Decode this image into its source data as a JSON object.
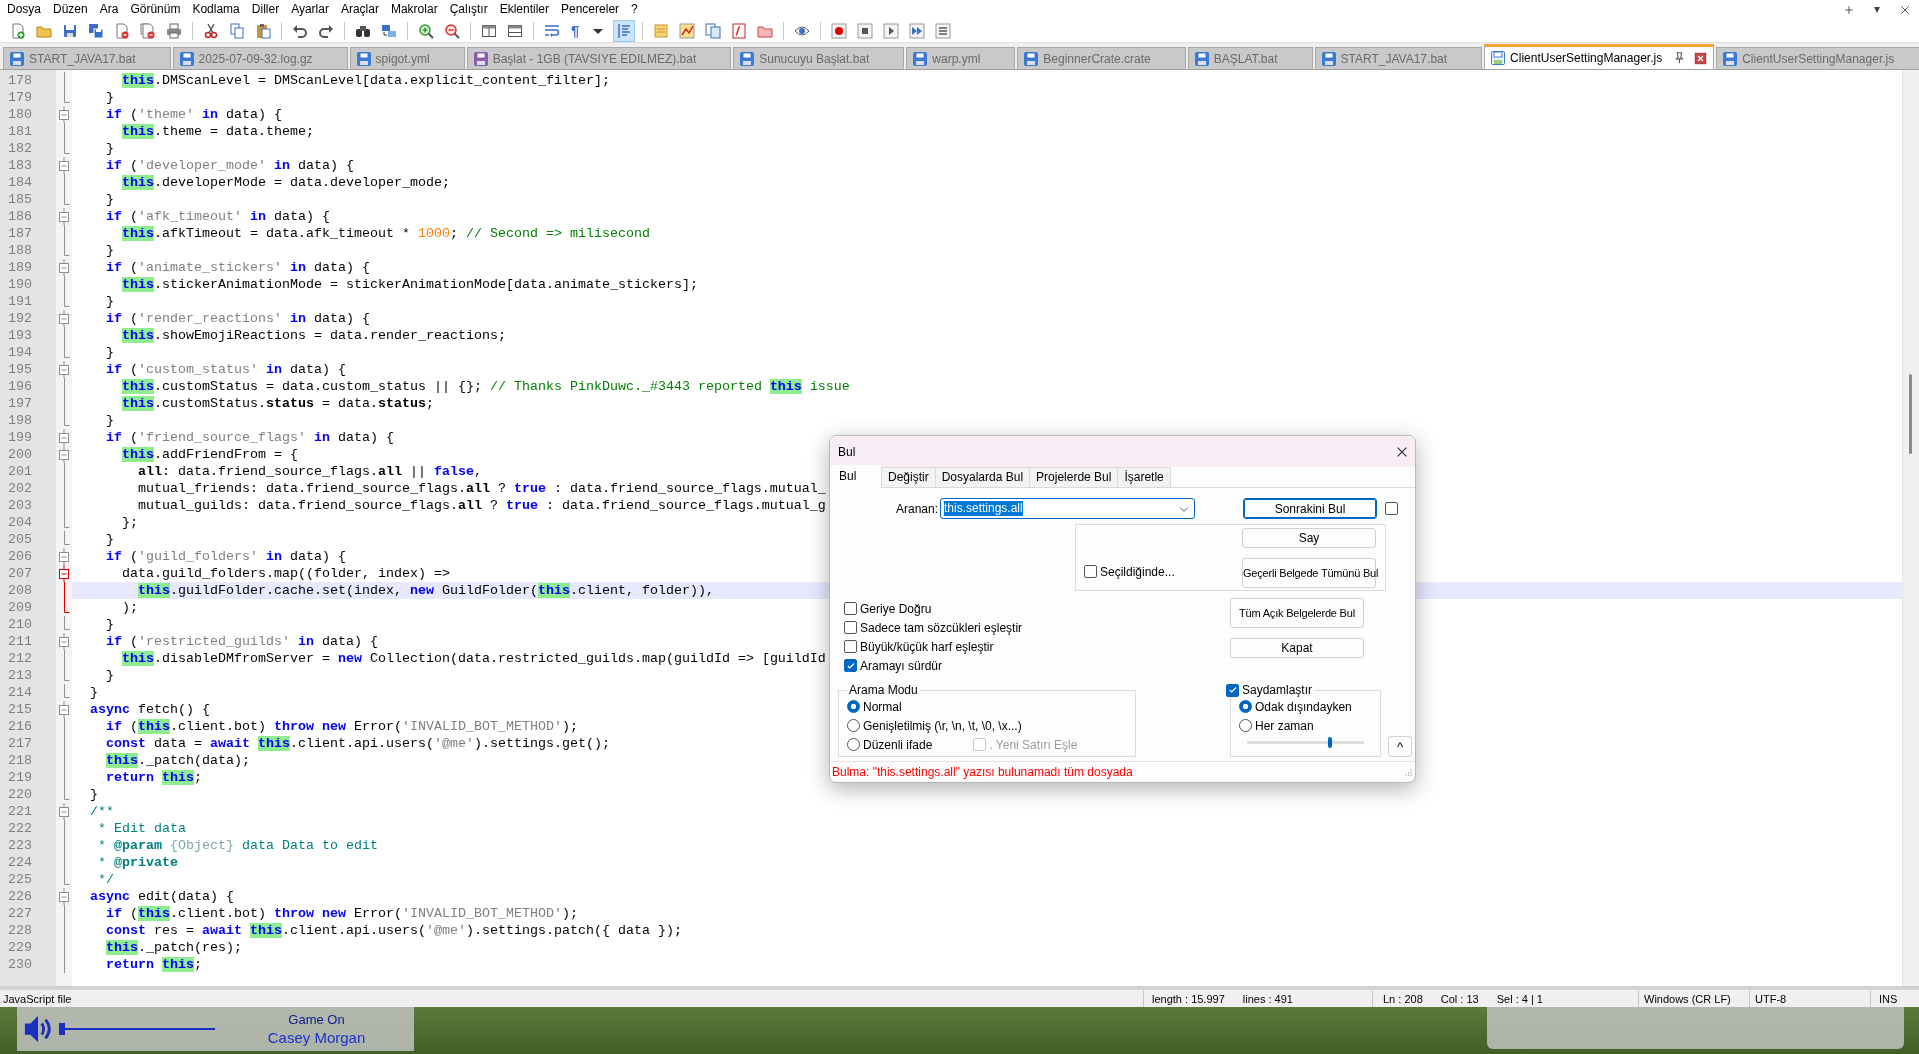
{
  "menu": [
    "Dosya",
    "Düzen",
    "Ara",
    "Görünüm",
    "Kodlama",
    "Diller",
    "Ayarlar",
    "Araçlar",
    "Makrolar",
    "Çalıştır",
    "Eklentiler",
    "Pencereler",
    "?"
  ],
  "toolbar": [
    {
      "kind": "new",
      "pressed": false
    },
    {
      "kind": "open",
      "pressed": false
    },
    {
      "kind": "save",
      "pressed": false
    },
    {
      "kind": "saveall",
      "pressed": false
    },
    {
      "kind": "close",
      "pressed": false
    },
    {
      "kind": "closeall",
      "pressed": false
    },
    {
      "kind": "print",
      "pressed": false
    },
    {
      "kind": "sep"
    },
    {
      "kind": "cut",
      "pressed": false
    },
    {
      "kind": "copy",
      "pressed": false
    },
    {
      "kind": "paste",
      "pressed": false
    },
    {
      "kind": "sep"
    },
    {
      "kind": "undo",
      "pressed": false
    },
    {
      "kind": "redo",
      "pressed": false
    },
    {
      "kind": "sep"
    },
    {
      "kind": "find",
      "pressed": false
    },
    {
      "kind": "replace",
      "pressed": false
    },
    {
      "kind": "sep"
    },
    {
      "kind": "zoomin",
      "pressed": false
    },
    {
      "kind": "zoomout",
      "pressed": false
    },
    {
      "kind": "sep"
    },
    {
      "kind": "syncv",
      "pressed": false
    },
    {
      "kind": "synch",
      "pressed": false
    },
    {
      "kind": "sep"
    },
    {
      "kind": "wrap",
      "pressed": false
    },
    {
      "kind": "glyph",
      "text": "¶",
      "pressed": false
    },
    {
      "kind": "caret",
      "pressed": false
    },
    {
      "kind": "indentguide",
      "pressed": true
    },
    {
      "kind": "sep"
    },
    {
      "kind": "udl",
      "pressed": false
    },
    {
      "kind": "docmap",
      "pressed": false
    },
    {
      "kind": "doclist",
      "pressed": false
    },
    {
      "kind": "funclist",
      "pressed": false
    },
    {
      "kind": "folderws",
      "pressed": false
    },
    {
      "kind": "sep"
    },
    {
      "kind": "monitor",
      "pressed": false
    },
    {
      "kind": "sep"
    },
    {
      "kind": "record",
      "pressed": false
    },
    {
      "kind": "stop",
      "pressed": false
    },
    {
      "kind": "play",
      "pressed": false
    },
    {
      "kind": "playmulti",
      "pressed": false
    },
    {
      "kind": "savemacro",
      "pressed": false
    }
  ],
  "tabs": [
    {
      "label": "START_JAVA17.bat",
      "kind": "saved",
      "selected": false
    },
    {
      "label": "2025-07-09-32.log.gz",
      "kind": "saved",
      "selected": false
    },
    {
      "label": "spigot.yml",
      "kind": "saved",
      "selected": false
    },
    {
      "label": "Başlat - 1GB (TAVSIYE EDILMEZ).bat",
      "kind": "readonly",
      "selected": false
    },
    {
      "label": "Sunucuyu Başlat.bat",
      "kind": "saved",
      "selected": false
    },
    {
      "label": "warp.yml",
      "kind": "saved",
      "selected": false
    },
    {
      "label": "BeginnerCrate.crate",
      "kind": "saved",
      "selected": false
    },
    {
      "label": "BAŞLAT.bat",
      "kind": "saved",
      "selected": false
    },
    {
      "label": "START_JAVA17.bat",
      "kind": "saved",
      "selected": false
    },
    {
      "label": "ClientUserSettingManager.js",
      "kind": "saved",
      "selected": true
    },
    {
      "label": "ClientUserSettingManager.js",
      "kind": "saved",
      "selected": false
    }
  ],
  "editor": {
    "lines": [
      {
        "number": "178",
        "kind": "mid",
        "active": false,
        "current": false,
        "tokens": [
          {
            "kind": "hl",
            "text": "      this"
          },
          ".DMScanLevel = DMScanLevel[data.explicit_content_filter];"
        ]
      },
      {
        "number": "179",
        "kind": "end",
        "active": false,
        "current": false,
        "tokens": [
          "    }"
        ]
      },
      {
        "number": "180",
        "kind": "open",
        "active": false,
        "current": false,
        "tokens": [
          {
            "kind": "kw",
            "text": "    if"
          },
          " (",
          {
            "kind": "str",
            "text": "'theme'"
          },
          {
            "kind": "kw",
            "text": " in"
          },
          " data) {"
        ]
      },
      {
        "number": "181",
        "kind": "mid",
        "active": false,
        "current": false,
        "tokens": [
          {
            "kind": "hl",
            "text": "      this"
          },
          ".theme = data.theme;"
        ]
      },
      {
        "number": "182",
        "kind": "end",
        "active": false,
        "current": false,
        "tokens": [
          "    }"
        ]
      },
      {
        "number": "183",
        "kind": "open",
        "active": false,
        "current": false,
        "tokens": [
          {
            "kind": "kw",
            "text": "    if"
          },
          " (",
          {
            "kind": "str",
            "text": "'developer_mode'"
          },
          {
            "kind": "kw",
            "text": " in"
          },
          " data) {"
        ]
      },
      {
        "number": "184",
        "kind": "mid",
        "active": false,
        "current": false,
        "tokens": [
          {
            "kind": "hl",
            "text": "      this"
          },
          ".developerMode = data.developer_mode;"
        ]
      },
      {
        "number": "185",
        "kind": "end",
        "active": false,
        "current": false,
        "tokens": [
          "    }"
        ]
      },
      {
        "number": "186",
        "kind": "open",
        "active": false,
        "current": false,
        "tokens": [
          {
            "kind": "kw",
            "text": "    if"
          },
          " (",
          {
            "kind": "str",
            "text": "'afk_timeout'"
          },
          {
            "kind": "kw",
            "text": " in"
          },
          " data) {"
        ]
      },
      {
        "number": "187",
        "kind": "mid",
        "active": false,
        "current": false,
        "tokens": [
          {
            "kind": "hl",
            "text": "      this"
          },
          ".afkTimeout = data.afk_timeout * ",
          {
            "kind": "num",
            "text": "1000"
          },
          ";",
          {
            "kind": "cm",
            "text": " // Second => milisecond"
          }
        ]
      },
      {
        "number": "188",
        "kind": "end",
        "active": false,
        "current": false,
        "tokens": [
          "    }"
        ]
      },
      {
        "number": "189",
        "kind": "open",
        "active": false,
        "current": false,
        "tokens": [
          {
            "kind": "kw",
            "text": "    if"
          },
          " (",
          {
            "kind": "str",
            "text": "'animate_stickers'"
          },
          {
            "kind": "kw",
            "text": " in"
          },
          " data) {"
        ]
      },
      {
        "number": "190",
        "kind": "mid",
        "active": false,
        "current": false,
        "tokens": [
          {
            "kind": "hl",
            "text": "      this"
          },
          ".stickerAnimationMode = stickerAnimationMode[data.animate_stickers];"
        ]
      },
      {
        "number": "191",
        "kind": "end",
        "active": false,
        "current": false,
        "tokens": [
          "    }"
        ]
      },
      {
        "number": "192",
        "kind": "open",
        "active": false,
        "current": false,
        "tokens": [
          {
            "kind": "kw",
            "text": "    if"
          },
          " (",
          {
            "kind": "str",
            "text": "'render_reactions'"
          },
          {
            "kind": "kw",
            "text": " in"
          },
          " data) {"
        ]
      },
      {
        "number": "193",
        "kind": "mid",
        "active": false,
        "current": false,
        "tokens": [
          {
            "kind": "hl",
            "text": "      this"
          },
          ".showEmojiReactions = data.render_reactions;"
        ]
      },
      {
        "number": "194",
        "kind": "end",
        "active": false,
        "current": false,
        "tokens": [
          "    }"
        ]
      },
      {
        "number": "195",
        "kind": "open",
        "active": false,
        "current": false,
        "tokens": [
          {
            "kind": "kw",
            "text": "    if"
          },
          " (",
          {
            "kind": "str",
            "text": "'custom_status'"
          },
          {
            "kind": "kw",
            "text": " in"
          },
          " data) {"
        ]
      },
      {
        "number": "196",
        "kind": "mid",
        "active": false,
        "current": false,
        "tokens": [
          {
            "kind": "hl",
            "text": "      this"
          },
          ".customStatus = data.custom_status || {};",
          {
            "kind": "cm",
            "text": " // Thanks PinkDuwc._#3443 reported "
          },
          {
            "kind": "hl",
            "text": "this"
          },
          {
            "kind": "cm",
            "text": " issue"
          }
        ]
      },
      {
        "number": "197",
        "kind": "mid",
        "active": false,
        "current": false,
        "tokens": [
          {
            "kind": "hl",
            "text": "      this"
          },
          ".customStatus.",
          {
            "kind": "b",
            "text": "status"
          },
          " = data.",
          {
            "kind": "b",
            "text": "status"
          },
          ";"
        ]
      },
      {
        "number": "198",
        "kind": "end",
        "active": false,
        "current": false,
        "tokens": [
          "    }"
        ]
      },
      {
        "number": "199",
        "kind": "open",
        "active": false,
        "current": false,
        "tokens": [
          {
            "kind": "kw",
            "text": "    if"
          },
          " (",
          {
            "kind": "str",
            "text": "'friend_source_flags'"
          },
          {
            "kind": "kw",
            "text": " in"
          },
          " data) {"
        ]
      },
      {
        "number": "200",
        "kind": "open",
        "active": false,
        "current": false,
        "tokens": [
          {
            "kind": "hl",
            "text": "      this"
          },
          ".addFriendFrom = {"
        ]
      },
      {
        "number": "201",
        "kind": "mid",
        "active": false,
        "current": false,
        "tokens": [
          {
            "kind": "b",
            "text": "        all"
          },
          ": data.friend_source_flags.",
          {
            "kind": "b",
            "text": "all"
          },
          " || ",
          {
            "kind": "kw",
            "text": "false"
          },
          ","
        ]
      },
      {
        "number": "202",
        "kind": "mid",
        "active": false,
        "current": false,
        "tokens": [
          "        mutual_friends: data.friend_source_flags.",
          {
            "kind": "b",
            "text": "all"
          },
          " ? ",
          {
            "kind": "kw",
            "text": "true"
          },
          " : data.friend_source_flags.mutual_"
        ]
      },
      {
        "number": "203",
        "kind": "mid",
        "active": false,
        "current": false,
        "tokens": [
          "        mutual_guilds: data.friend_source_flags.",
          {
            "kind": "b",
            "text": "all"
          },
          " ? ",
          {
            "kind": "kw",
            "text": "true"
          },
          " : data.friend_source_flags.mutual_g"
        ]
      },
      {
        "number": "204",
        "kind": "end",
        "active": false,
        "current": false,
        "tokens": [
          "      };"
        ]
      },
      {
        "number": "205",
        "kind": "end",
        "active": false,
        "current": false,
        "tokens": [
          "    }"
        ]
      },
      {
        "number": "206",
        "kind": "open",
        "active": false,
        "current": false,
        "tokens": [
          {
            "kind": "kw",
            "text": "    if"
          },
          " (",
          {
            "kind": "str",
            "text": "'guild_folders'"
          },
          {
            "kind": "kw",
            "text": " in"
          },
          " data) {"
        ]
      },
      {
        "number": "207",
        "kind": "open",
        "active": true,
        "current": false,
        "tokens": [
          "      data.guild_folders.map((folder, index) =>"
        ]
      },
      {
        "number": "208",
        "kind": "mid",
        "active": true,
        "current": true,
        "tokens": [
          {
            "kind": "hl",
            "text": "        this"
          },
          ".guildFolder.cache.set(index,",
          {
            "kind": "kw",
            "text": " new"
          },
          " GuildFolder(",
          {
            "kind": "hl",
            "text": "this"
          },
          ".client, folder)),"
        ]
      },
      {
        "number": "209",
        "kind": "end",
        "active": true,
        "current": false,
        "tokens": [
          "      );"
        ]
      },
      {
        "number": "210",
        "kind": "end",
        "active": false,
        "current": false,
        "tokens": [
          "    }"
        ]
      },
      {
        "number": "211",
        "kind": "open",
        "active": false,
        "current": false,
        "tokens": [
          {
            "kind": "kw",
            "text": "    if"
          },
          " (",
          {
            "kind": "str",
            "text": "'restricted_guilds'"
          },
          {
            "kind": "kw",
            "text": " in"
          },
          " data) {"
        ]
      },
      {
        "number": "212",
        "kind": "mid",
        "active": false,
        "current": false,
        "tokens": [
          {
            "kind": "hl",
            "text": "      this"
          },
          ".disableDMfromServer =",
          {
            "kind": "kw",
            "text": " new"
          },
          " Collection(data.restricted_guilds.map(guildId => [guildId"
        ]
      },
      {
        "number": "213",
        "kind": "end",
        "active": false,
        "current": false,
        "tokens": [
          "    }"
        ]
      },
      {
        "number": "214",
        "kind": "end",
        "active": false,
        "current": false,
        "tokens": [
          "  }"
        ]
      },
      {
        "number": "215",
        "kind": "open",
        "active": false,
        "current": false,
        "tokens": [
          {
            "kind": "kw",
            "text": "  async"
          },
          " fetch() {"
        ]
      },
      {
        "number": "216",
        "kind": "mid",
        "active": false,
        "current": false,
        "tokens": [
          {
            "kind": "kw",
            "text": "    if"
          },
          " (",
          {
            "kind": "hl",
            "text": "this"
          },
          ".client.bot)",
          {
            "kind": "kw",
            "text": " throw new"
          },
          " Error(",
          {
            "kind": "str",
            "text": "'INVALID_BOT_METHOD'"
          },
          ");"
        ]
      },
      {
        "number": "217",
        "kind": "mid",
        "active": false,
        "current": false,
        "tokens": [
          {
            "kind": "kw",
            "text": "    const"
          },
          " data =",
          {
            "kind": "kw",
            "text": " await"
          },
          {
            "kind": "hl",
            "text": " this"
          },
          ".client.api.users(",
          {
            "kind": "str",
            "text": "'@me'"
          },
          ").settings.get();"
        ]
      },
      {
        "number": "218",
        "kind": "mid",
        "active": false,
        "current": false,
        "tokens": [
          {
            "kind": "hl",
            "text": "    this"
          },
          "._patch(data);"
        ]
      },
      {
        "number": "219",
        "kind": "mid",
        "active": false,
        "current": false,
        "tokens": [
          {
            "kind": "kw",
            "text": "    return"
          },
          {
            "kind": "hl",
            "text": " this"
          },
          ";"
        ]
      },
      {
        "number": "220",
        "kind": "end",
        "active": false,
        "current": false,
        "tokens": [
          "  }"
        ]
      },
      {
        "number": "221",
        "kind": "open",
        "active": false,
        "current": false,
        "tokens": [
          {
            "kind": "doc",
            "text": "  /**"
          }
        ]
      },
      {
        "number": "222",
        "kind": "mid",
        "active": false,
        "current": false,
        "tokens": [
          {
            "kind": "doc",
            "text": "   * Edit data"
          }
        ]
      },
      {
        "number": "223",
        "kind": "mid",
        "active": false,
        "current": false,
        "tokens": [
          {
            "kind": "doc",
            "text": "   *"
          },
          {
            "kind": "doctag",
            "text": " @param"
          },
          {
            "kind": "doctype",
            "text": " {Object}"
          },
          {
            "kind": "doc",
            "text": " data Data to edit"
          }
        ]
      },
      {
        "number": "224",
        "kind": "mid",
        "active": false,
        "current": false,
        "tokens": [
          {
            "kind": "doc",
            "text": "   *"
          },
          {
            "kind": "doctag",
            "text": " @private"
          }
        ]
      },
      {
        "number": "225",
        "kind": "end",
        "active": false,
        "current": false,
        "tokens": [
          {
            "kind": "doc",
            "text": "   */"
          }
        ]
      },
      {
        "number": "226",
        "kind": "open",
        "active": false,
        "current": false,
        "tokens": [
          {
            "kind": "kw",
            "text": "  async"
          },
          " edit(data) {"
        ]
      },
      {
        "number": "227",
        "kind": "mid",
        "active": false,
        "current": false,
        "tokens": [
          {
            "kind": "kw",
            "text": "    if"
          },
          " (",
          {
            "kind": "hl",
            "text": "this"
          },
          ".client.bot)",
          {
            "kind": "kw",
            "text": " throw new"
          },
          " Error(",
          {
            "kind": "str",
            "text": "'INVALID_BOT_METHOD'"
          },
          ");"
        ]
      },
      {
        "number": "228",
        "kind": "mid",
        "active": false,
        "current": false,
        "tokens": [
          {
            "kind": "kw",
            "text": "    const"
          },
          " res =",
          {
            "kind": "kw",
            "text": " await"
          },
          {
            "kind": "hl",
            "text": " this"
          },
          ".client.api.users(",
          {
            "kind": "str",
            "text": "'@me'"
          },
          ").settings.patch({ data });"
        ]
      },
      {
        "number": "229",
        "kind": "mid",
        "active": false,
        "current": false,
        "tokens": [
          {
            "kind": "hl",
            "text": "    this"
          },
          "._patch(res);"
        ]
      },
      {
        "number": "230",
        "kind": "mid",
        "active": false,
        "current": false,
        "tokens": [
          {
            "kind": "kw",
            "text": "    return"
          },
          {
            "kind": "hl",
            "text": " this"
          },
          ";"
        ]
      }
    ]
  },
  "find_dialog": {
    "title": "Bul",
    "tabs": [
      {
        "label": "Bul",
        "selected": true
      },
      {
        "label": "Değiştir",
        "selected": false
      },
      {
        "label": "Dosyalarda Bul",
        "selected": false
      },
      {
        "label": "Projelerde Bul",
        "selected": false
      },
      {
        "label": "İşaretle",
        "selected": false
      }
    ],
    "search": {
      "label": "Aranan:",
      "value": "this.settings.all",
      "value_selected": true
    },
    "buttons": [
      {
        "label": "Sonrakini Bul",
        "default": true
      },
      {
        "label": "Say",
        "default": false
      },
      {
        "label": "Geçerli Belgede Tümünü Bul",
        "default": false
      },
      {
        "label": "Tüm Açık Belgelerde Bul",
        "default": false
      },
      {
        "label": "Kapat",
        "default": false
      }
    ],
    "find_next_option": {
      "checked": false
    },
    "in_selection": {
      "label": "Seçildiğinde...",
      "checked": false
    },
    "options": [
      {
        "label": "Geriye Doğru",
        "checked": false
      },
      {
        "label": "Sadece tam sözcükleri eşleştir",
        "checked": false
      },
      {
        "label": "Büyük/küçük harf eşleştir",
        "checked": false
      },
      {
        "label": "Aramayı sürdür",
        "checked": true
      }
    ],
    "search_mode": {
      "title": "Arama Modu",
      "modes": [
        {
          "label": "Normal",
          "selected": true
        },
        {
          "label": "Genişletilmiş (\\r, \\n, \\t, \\0, \\x...)",
          "selected": false
        },
        {
          "label": "Düzenli ifade",
          "selected": false
        }
      ],
      "newline_option": {
        "label": ". Yeni Satırı Eşle",
        "checked": false,
        "disabled": true
      }
    },
    "transparency": {
      "label": "Saydamlaştır",
      "checked": true,
      "modes": [
        {
          "label": "Odak dışındayken",
          "selected": true
        },
        {
          "label": "Her zaman",
          "selected": false
        }
      ],
      "level": 0.71
    },
    "collapse_button": "^",
    "status": "Bulma: \"this.settings.all\" yazısı bulunamadı tüm dosyada"
  },
  "status_bar": {
    "file_type": "JavaScript file",
    "length": "length : 15.997",
    "lines": "lines : 491",
    "line": "Ln : 208",
    "column": "Col : 13",
    "selection": "Sel : 4 | 1",
    "eol": "Windows (CR LF)",
    "encoding": "UTF-8",
    "mode": "INS"
  },
  "background_panel": {
    "title": "Game On",
    "subtitle": "Casey Morgan"
  }
}
